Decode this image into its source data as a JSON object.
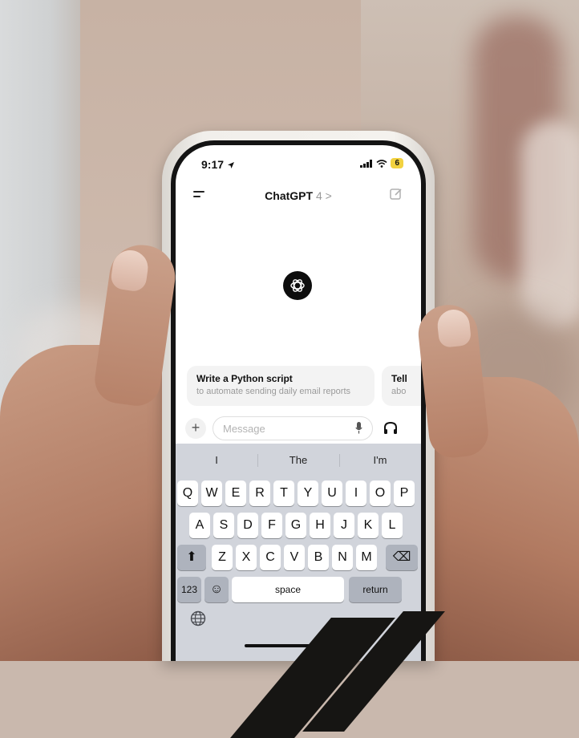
{
  "status_bar": {
    "time": "9:17",
    "battery": "6"
  },
  "nav": {
    "title": "ChatGPT",
    "version": "4 >"
  },
  "suggestions": [
    {
      "title": "Write a Python script",
      "subtitle": "to automate sending daily email reports"
    },
    {
      "title": "Tell",
      "subtitle": "abo"
    }
  ],
  "composer": {
    "placeholder": "Message",
    "plus_label": "+"
  },
  "keyboard": {
    "predictions": [
      "I",
      "The",
      "I'm"
    ],
    "row1": [
      "Q",
      "W",
      "E",
      "R",
      "T",
      "Y",
      "U",
      "I",
      "O",
      "P"
    ],
    "row2": [
      "A",
      "S",
      "D",
      "F",
      "G",
      "H",
      "J",
      "K",
      "L"
    ],
    "row3": [
      "Z",
      "X",
      "C",
      "V",
      "B",
      "N",
      "M"
    ],
    "shift_glyph": "⬆",
    "delete_glyph": "⌫",
    "numbers_label": "123",
    "emoji_glyph": "☺",
    "space_label": "space",
    "return_label": "return"
  },
  "colors": {
    "battery": "#f2d240",
    "keyboard_bg": "#d1d4db",
    "function_key": "#aeb3bd"
  },
  "icons": [
    "menu-icon",
    "edit-icon",
    "openai-logo-icon",
    "mic-icon",
    "headphones-icon",
    "globe-icon",
    "location-arrow-icon",
    "signal-icon",
    "wifi-icon"
  ]
}
